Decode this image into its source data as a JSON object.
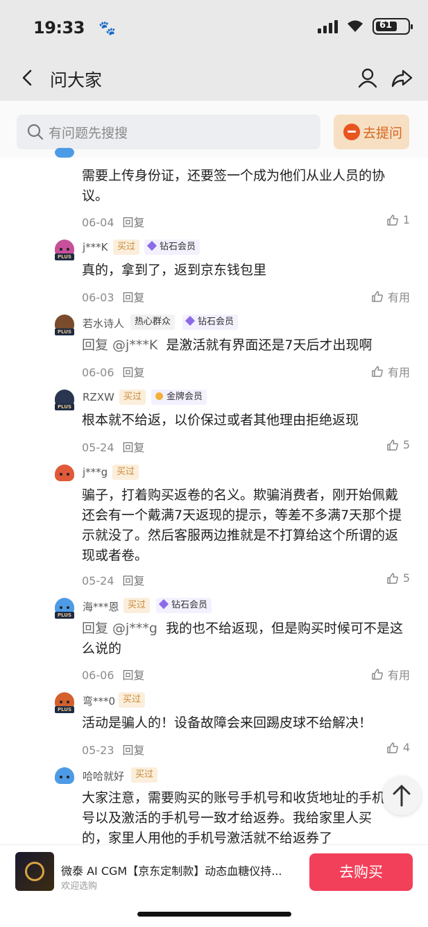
{
  "status_bar": {
    "time": "19:33",
    "paw": "🐾",
    "battery": "61"
  },
  "nav": {
    "title": "问大家"
  },
  "search": {
    "placeholder": "有问题先搜搜",
    "ask_label": "去提问"
  },
  "comments": [
    {
      "name": "",
      "body": "需要上传身份证，还要签一个成为他们从业人员的协议。",
      "date": "06-04",
      "reply": "回复",
      "like": "1",
      "avatar_color": "#4d9be6"
    },
    {
      "name": "j***K",
      "badge": "买过",
      "level": "钻石会员",
      "body": "真的，拿到了，返到京东钱包里",
      "date": "06-03",
      "reply": "回复",
      "like": "有用",
      "avatar_color": "#c7509a"
    },
    {
      "name": "若水诗人",
      "tag": "热心群众",
      "level": "钻石会员",
      "reply_prefix": "回复 @j***K",
      "body": "是激活就有界面还是7天后才出现啊",
      "date": "06-06",
      "reply": "回复",
      "like": "有用",
      "avatar_color": "#7a4b2c"
    },
    {
      "name": "RZXW",
      "badge": "买过",
      "level": "金牌会员",
      "body": "根本就不给返，以价保过或者其他理由拒绝返现",
      "date": "05-24",
      "reply": "回复",
      "like": "5",
      "avatar_color": "#2a3650"
    },
    {
      "name": "j***g",
      "badge": "买过",
      "body": "骗子，打着购买返卷的名义。欺骗消费者，刚开始佩戴还会有一个戴满7天返现的提示，等差不多满7天那个提示就没了。然后客服两边推就是不打算给这个所谓的返现或者卷。",
      "date": "05-24",
      "reply": "回复",
      "like": "5",
      "avatar_color": "#e05a3a"
    },
    {
      "name": "海***恩",
      "badge": "买过",
      "level": "钻石会员",
      "reply_prefix": "回复 @j***g",
      "body": "我的也不给返现，但是购买时候可不是这么说的",
      "date": "06-06",
      "reply": "回复",
      "like": "有用",
      "avatar_color": "#4d9be6"
    },
    {
      "name": "弯***0",
      "badge": "买过",
      "body": "活动是骗人的！设备故障会来回踢皮球不给解决！",
      "date": "05-23",
      "reply": "回复",
      "like": "4",
      "avatar_color": "#d4602e"
    },
    {
      "name": "哈哈就好",
      "badge": "买过",
      "body": "大家注意，需要购买的账号手机号和收货地址的手机号以及激活的手机号一致才给返券。我给家里人买的，家里人用他的手机号激活就不给返券了",
      "avatar_color": "#4d9be6"
    }
  ],
  "product": {
    "title": "微泰 AI CGM【京东定制款】动态血糖仪持...",
    "subtitle": "欢迎选购",
    "buy_label": "去购买"
  }
}
